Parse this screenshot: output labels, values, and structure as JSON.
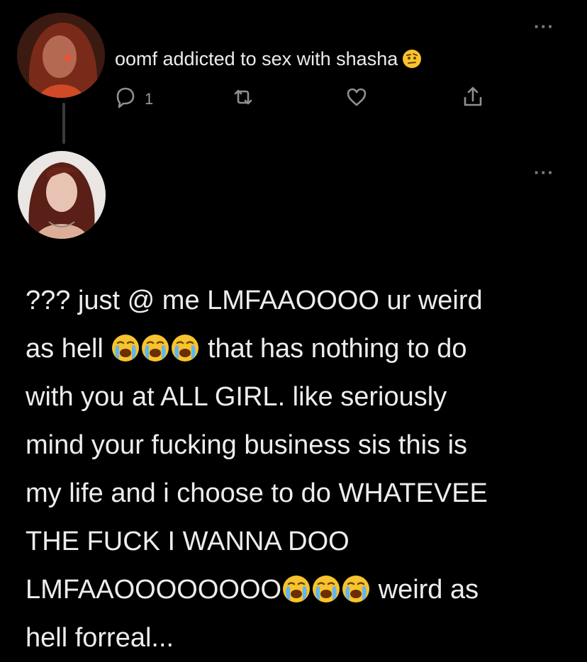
{
  "reply_tweet": {
    "text": "oomf addicted to sex with shasha",
    "emoji": "raised-eyebrow-face",
    "reply_count": "1"
  },
  "main_tweet": {
    "line1": "??? just @ me LMFAAOOOO ur weird",
    "line2a": "as hell",
    "line2b": "that has nothing to do",
    "line3": "with you at ALL GIRL. like seriously",
    "line4": "mind your fucking business sis this is",
    "line5": "my life and i choose to do WHATEVEE",
    "line6": "THE FUCK I WANNA DOO",
    "line7a": "LMFAAOOOOOOOO",
    "line7b": "weird as",
    "line8": "hell forreal...",
    "emoji": "loudly-crying-face"
  },
  "icons": {
    "reply": "reply-icon",
    "retweet": "retweet-icon",
    "like": "heart-icon",
    "share": "share-icon",
    "more": "more-icon"
  },
  "colors": {
    "background": "#000000",
    "text": "#ededed",
    "muted": "#8f8f8f",
    "emoji_yellow": "#f7c32e"
  }
}
